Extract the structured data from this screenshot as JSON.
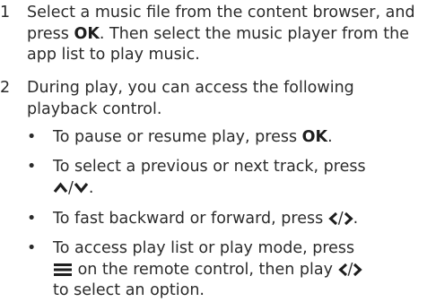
{
  "steps": [
    {
      "number": "1",
      "text_a": "Select a music file from the content browser, and press ",
      "bold_a": "OK",
      "text_b": ". Then select the music player from the app list to play music."
    },
    {
      "number": "2",
      "text": "During play, you can access the following playback control.",
      "bullets": [
        {
          "marker": "•",
          "text_a": "To pause or resume play, press ",
          "bold": "OK",
          "text_b": "."
        },
        {
          "marker": "•",
          "text_a": "To select a previous or next track, press ",
          "icons": [
            "up-chevron-icon",
            "down-chevron-icon"
          ],
          "separator": "/",
          "text_b": "."
        },
        {
          "marker": "•",
          "text_a": "To fast backward or forward, press ",
          "icons": [
            "left-chevron-icon",
            "right-chevron-icon"
          ],
          "separator": "/",
          "text_b": "."
        },
        {
          "marker": "•",
          "icons_lead": [
            "menu-icon"
          ],
          "text_a": " on the remote control, then play ",
          "text_pre": "To access play list or play mode, press ",
          "icons": [
            "left-chevron-icon",
            "right-chevron-icon"
          ],
          "separator": "/",
          "text_b": " to select an option."
        }
      ]
    }
  ]
}
